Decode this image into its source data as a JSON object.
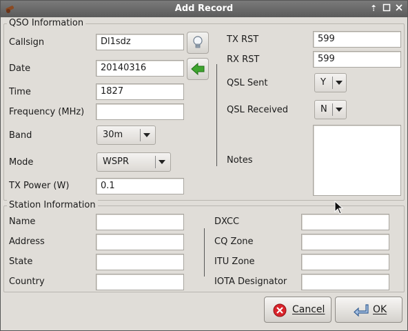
{
  "window": {
    "title": "Add Record"
  },
  "qso": {
    "group_title": "QSO Information",
    "callsign_label": "Callsign",
    "callsign_value": "Dl1sdz",
    "date_label": "Date",
    "date_value": "20140316",
    "time_label": "Time",
    "time_value": "1827",
    "frequency_label": "Frequency (MHz)",
    "frequency_value": "",
    "band_label": "Band",
    "band_value": "30m",
    "mode_label": "Mode",
    "mode_value": "WSPR",
    "txpower_label": "TX Power (W)",
    "txpower_value": "0.1",
    "txrst_label": "TX RST",
    "txrst_value": "599",
    "rxrst_label": "RX RST",
    "rxrst_value": "599",
    "qslsent_label": "QSL Sent",
    "qslsent_value": "Y",
    "qslreceived_label": "QSL Received",
    "qslreceived_value": "N",
    "notes_label": "Notes",
    "notes_value": ""
  },
  "station": {
    "group_title": "Station Information",
    "name_label": "Name",
    "name_value": "",
    "address_label": "Address",
    "address_value": "",
    "state_label": "State",
    "state_value": "",
    "country_label": "Country",
    "country_value": "",
    "dxcc_label": "DXCC",
    "dxcc_value": "",
    "cqzone_label": "CQ Zone",
    "cqzone_value": "",
    "ituzone_label": "ITU Zone",
    "ituzone_value": "",
    "iota_label": "IOTA Designator",
    "iota_value": ""
  },
  "buttons": {
    "cancel_label": "Cancel",
    "ok_label": "OK"
  },
  "icons": {
    "lookup": "lightbulb-icon",
    "copy_date": "green-left-arrow-icon",
    "cancel": "red-x-circle-icon",
    "ok": "return-arrow-icon"
  },
  "colors": {
    "titlebar": "#5b5b5b",
    "window_bg": "#e0ddd8",
    "cancel_red": "#d9242b",
    "arrow_green": "#3ea52e"
  }
}
